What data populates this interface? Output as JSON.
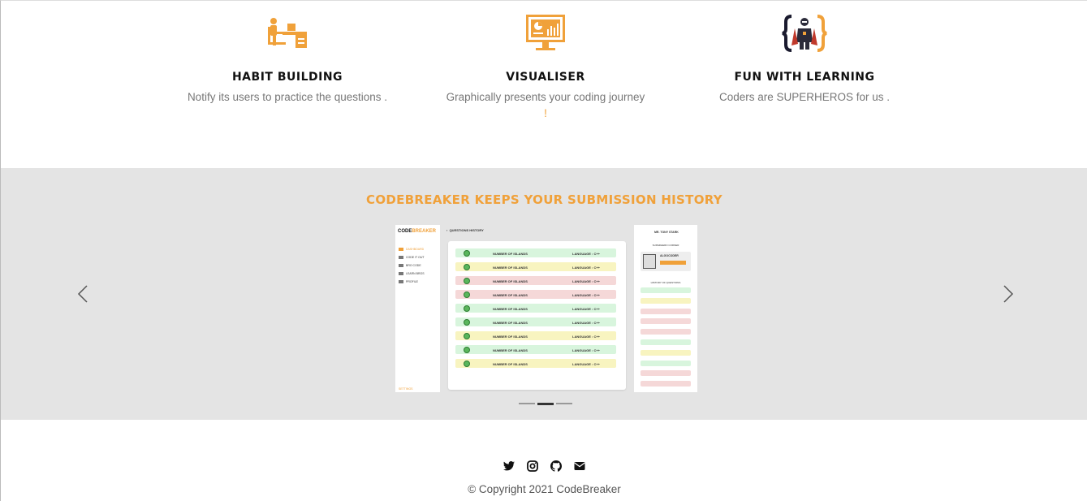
{
  "features": [
    {
      "icon": "desk-worker-icon",
      "title": "HABIT BUILDING",
      "description": "Notify its users to practice the questions .",
      "accent": ""
    },
    {
      "icon": "monitor-chart-icon",
      "title": "VISUALISER",
      "description": "Graphically presents your coding journey",
      "accent": "!"
    },
    {
      "icon": "superhero-braces-icon",
      "title": "FUN WITH LEARNING",
      "description": "Coders are SUPERHEROS for us .",
      "accent": ""
    }
  ],
  "carousel": {
    "title": "CODEBREAKER KEEPS YOUR SUBMISSION HISTORY",
    "prev_icon": "chevron-left-icon",
    "next_icon": "chevron-right-icon",
    "active_slide": 2,
    "slide_count": 3,
    "slide": {
      "brand_dark": "CODE",
      "brand_accent": "BREAKER",
      "nav": [
        "DASHBOARD",
        "CODE IT OUT",
        "BRO CODE",
        "LEARN BROS",
        "PROFILE"
      ],
      "settings": "SETTINGS",
      "header": "QUESTIONS HISTORY",
      "rows": [
        {
          "question": "NUMBER OF ISLANDS",
          "language": "LANGUAGE : C++",
          "status": "green"
        },
        {
          "question": "NUMBER OF ISLANDS",
          "language": "LANGUAGE : C++",
          "status": "yellow"
        },
        {
          "question": "NUMBER OF ISLANDS",
          "language": "LANGUAGE : C++",
          "status": "red"
        },
        {
          "question": "NUMBER OF ISLANDS",
          "language": "LANGUAGE : C++",
          "status": "red"
        },
        {
          "question": "NUMBER OF ISLANDS",
          "language": "LANGUAGE : C++",
          "status": "green"
        },
        {
          "question": "NUMBER OF ISLANDS",
          "language": "LANGUAGE : C++",
          "status": "green"
        },
        {
          "question": "NUMBER OF ISLANDS",
          "language": "LANGUAGE : C++",
          "status": "yellow"
        },
        {
          "question": "NUMBER OF ISLANDS",
          "language": "LANGUAGE : C++",
          "status": "green"
        },
        {
          "question": "NUMBER OF ISLANDS",
          "language": "LANGUAGE : C++",
          "status": "yellow"
        }
      ],
      "user": "MR. TONY STARK",
      "hero_title": "SUPERHERO CORNER",
      "hero_badge": "ALGOCODER",
      "history_title": "HISTORY OF QUESTIONS",
      "history_statuses": [
        "green",
        "yellow",
        "red",
        "red",
        "red",
        "green",
        "yellow",
        "green",
        "red",
        "red"
      ]
    }
  },
  "colors": {
    "accent": "#f0a13a",
    "band_background": "#e4e4e4",
    "green_row": "#d8f5dd",
    "yellow_row": "#f8f4c0",
    "red_row": "#f5d8d8"
  },
  "footer": {
    "social": [
      "twitter-icon",
      "instagram-icon",
      "github-icon",
      "envelope-icon"
    ],
    "copyright": "© Copyright 2021 CodeBreaker"
  }
}
